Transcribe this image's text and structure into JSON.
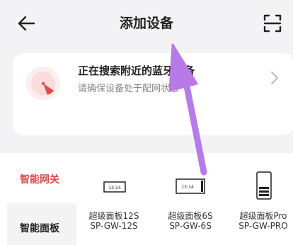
{
  "header": {
    "title": "添加设备"
  },
  "search": {
    "title": "正在搜索附近的蓝牙设备",
    "subtitle": "请确保设备处于配网状态"
  },
  "categories": [
    {
      "label": "智能网关",
      "active": false
    },
    {
      "label": "智能面板",
      "active": true
    }
  ],
  "devices": [
    {
      "name": "超级面板12S",
      "model": "SP-GW-12S",
      "screen_text": "13:14"
    },
    {
      "name": "超级面板6S",
      "model": "SP-GW-6S",
      "screen_text": "13:14"
    },
    {
      "name": "超级面板Pro",
      "model": "SP-GW-PRO"
    }
  ],
  "colors": {
    "accent": "#e04a4a",
    "annotation_arrow": "#b77be9"
  },
  "icons": [
    "back-arrow-icon",
    "scan-icon",
    "radar-icon",
    "chevron-right-icon"
  ]
}
